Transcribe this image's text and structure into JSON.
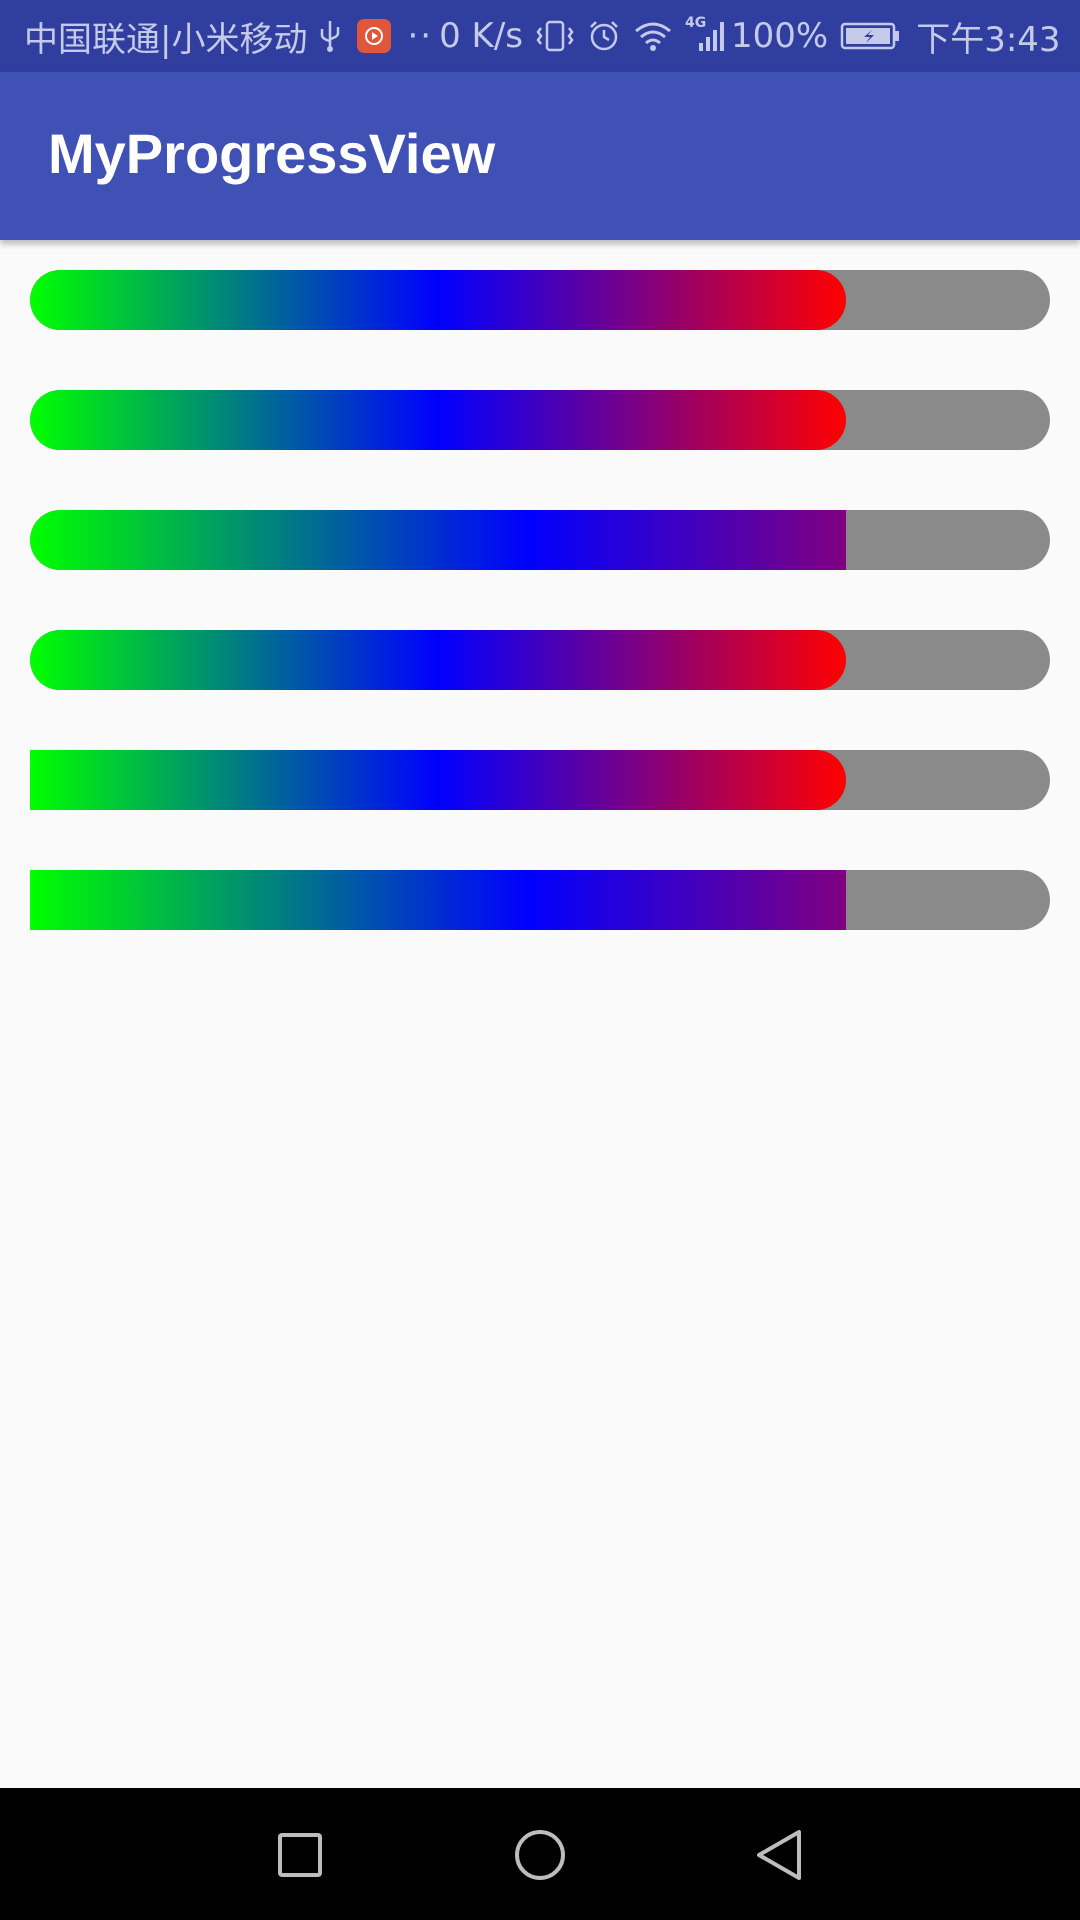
{
  "status_bar": {
    "carrier": "中国联通|小米移动",
    "dots": "··",
    "net_speed": "0 K/s",
    "network_type": "4G",
    "battery": "100%",
    "time": "下午3:43",
    "icons": [
      "usb-icon",
      "app-notification-icon",
      "vibrate-icon",
      "alarm-icon",
      "wifi-icon",
      "signal-icon",
      "battery-icon"
    ]
  },
  "app_bar": {
    "title": "MyProgressView",
    "color": "#3F51B5"
  },
  "progress_bars": [
    {
      "progress": 0.8,
      "fill_style": "rounded"
    },
    {
      "progress": 0.8,
      "fill_style": "rounded"
    },
    {
      "progress": 0.8,
      "fill_style": "flat-end"
    },
    {
      "progress": 0.8,
      "fill_style": "rounded"
    },
    {
      "progress": 0.8,
      "fill_style": "square-start"
    },
    {
      "progress": 0.8,
      "fill_style": "square-start-flat-end"
    }
  ],
  "colors": {
    "gradient_start": "#00FF00",
    "gradient_mid": "#0000FF",
    "gradient_end": "#FF0000",
    "track": "#8A8A8A",
    "status_bar": "#303F9F"
  },
  "nav_bar": {
    "icons": [
      "recents-icon",
      "home-icon",
      "back-icon"
    ]
  }
}
